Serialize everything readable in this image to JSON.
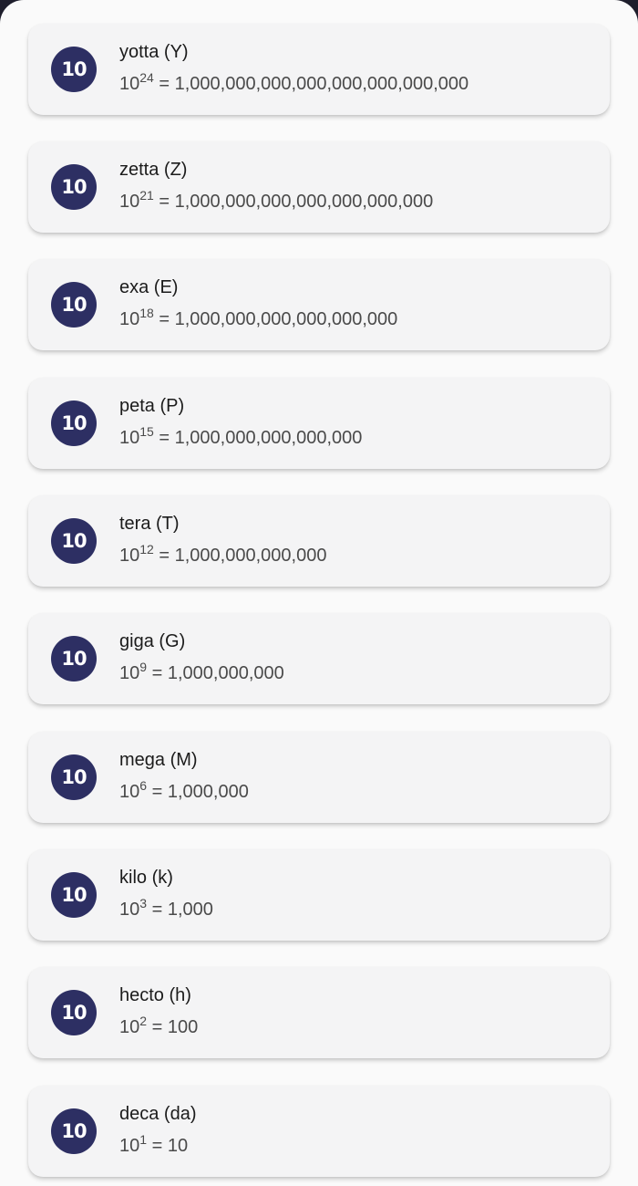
{
  "badge_text": "10",
  "colors": {
    "badge_bg": "#2d2f63",
    "card_bg": "#f4f4f5",
    "page_bg": "#fafafa"
  },
  "prefixes": [
    {
      "name": "yotta (Y)",
      "base": "10",
      "exponent": "24",
      "equals": " = 1,000,000,000,000,000,000,000,000"
    },
    {
      "name": "zetta (Z)",
      "base": "10",
      "exponent": "21",
      "equals": " = 1,000,000,000,000,000,000,000"
    },
    {
      "name": "exa (E)",
      "base": "10",
      "exponent": "18",
      "equals": " = 1,000,000,000,000,000,000"
    },
    {
      "name": "peta (P)",
      "base": "10",
      "exponent": "15",
      "equals": " = 1,000,000,000,000,000"
    },
    {
      "name": "tera (T)",
      "base": "10",
      "exponent": "12",
      "equals": " = 1,000,000,000,000"
    },
    {
      "name": "giga (G)",
      "base": "10",
      "exponent": "9",
      "equals": " = 1,000,000,000"
    },
    {
      "name": "mega (M)",
      "base": "10",
      "exponent": "6",
      "equals": " = 1,000,000"
    },
    {
      "name": "kilo (k)",
      "base": "10",
      "exponent": "3",
      "equals": " = 1,000"
    },
    {
      "name": "hecto (h)",
      "base": "10",
      "exponent": "2",
      "equals": " = 100"
    },
    {
      "name": "deca (da)",
      "base": "10",
      "exponent": "1",
      "equals": " = 10"
    }
  ]
}
